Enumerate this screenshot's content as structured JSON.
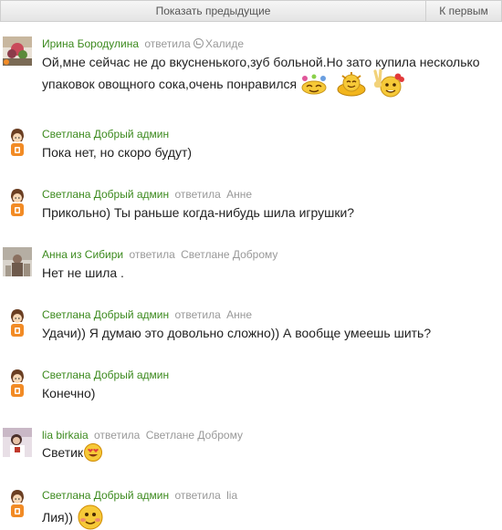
{
  "nav": {
    "prev_label": "Показать предыдущие",
    "first_label": "К первым"
  },
  "messages": [
    {
      "author": "Ирина Бородулина",
      "reply_prefix": "ответила",
      "reply_to": "Халиде",
      "text_line1": "Ой,мне сейчас не до вкусненького,зуб больной.Но зато купила несколько",
      "text_line2": "упаковок овощного сока,очень понравился",
      "avatar": "user-photo-irina"
    },
    {
      "author": "Светлана Добрый админ",
      "reply_prefix": "",
      "reply_to": "",
      "text_line1": "Пока нет, но скоро будут)",
      "avatar": "admin-avatar"
    },
    {
      "author": "Светлана Добрый админ",
      "reply_prefix": "ответила",
      "reply_to": "Анне",
      "text_line1": "Прикольно) Ты раньше когда-нибудь шила игрушки?",
      "avatar": "admin-avatar"
    },
    {
      "author": "Анна из Сибири",
      "reply_prefix": "ответила",
      "reply_to": "Светлане Доброму",
      "text_line1": "Нет не шила .",
      "avatar": "user-photo-anna"
    },
    {
      "author": "Светлана Добрый админ",
      "reply_prefix": "ответила",
      "reply_to": "Анне",
      "text_line1": "Удачи)) Я думаю это довольно сложно)) А вообще умеешь шить?",
      "avatar": "admin-avatar"
    },
    {
      "author": "Светлана Добрый админ",
      "reply_prefix": "",
      "reply_to": "",
      "text_line1": "Конечно)",
      "avatar": "admin-avatar"
    },
    {
      "author": "lia birkaia",
      "reply_prefix": "ответила",
      "reply_to": "Светлане Доброму",
      "text_line1": "Светик",
      "avatar": "user-photo-lia"
    },
    {
      "author": "Светлана Добрый админ",
      "reply_prefix": "ответила",
      "reply_to": "lia",
      "text_line1": "Лия))",
      "avatar": "admin-avatar"
    }
  ],
  "colors": {
    "author": "#3c8a1e",
    "muted": "#999999",
    "admin_shirt": "#f28b25"
  }
}
